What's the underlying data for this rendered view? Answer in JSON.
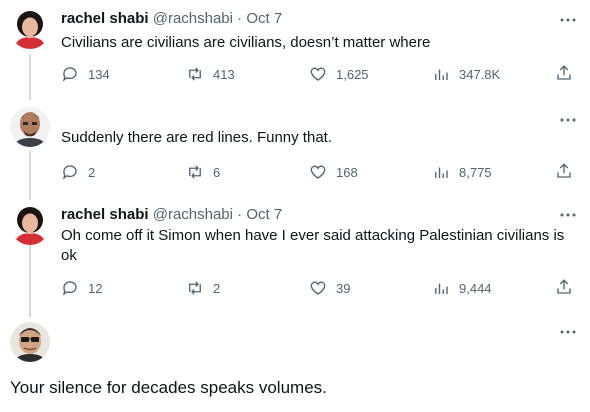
{
  "tweets": [
    {
      "name": "rachel shabi",
      "handle": "@rachshabi",
      "separator": "·",
      "time": "Oct 7",
      "text": "Civilians are civilians are civilians, doesn’t matter where",
      "replies": "134",
      "retweets": "413",
      "likes": "1,625",
      "views": "347.8K"
    },
    {
      "text": "Suddenly there are red lines. Funny that.",
      "replies": "2",
      "retweets": "6",
      "likes": "168",
      "views": "8,775"
    },
    {
      "name": "rachel shabi",
      "handle": "@rachshabi",
      "separator": "·",
      "time": "Oct 7",
      "text": "Oh come off it Simon when have I ever said attacking Palestinian civilians is ok",
      "replies": "12",
      "retweets": "2",
      "likes": "39",
      "views": "9,444"
    },
    {
      "text": "Your silence for decades speaks volumes."
    }
  ],
  "colors": {
    "text": "#0f1419",
    "secondary": "#536471",
    "thread_line": "#cfd9de"
  }
}
